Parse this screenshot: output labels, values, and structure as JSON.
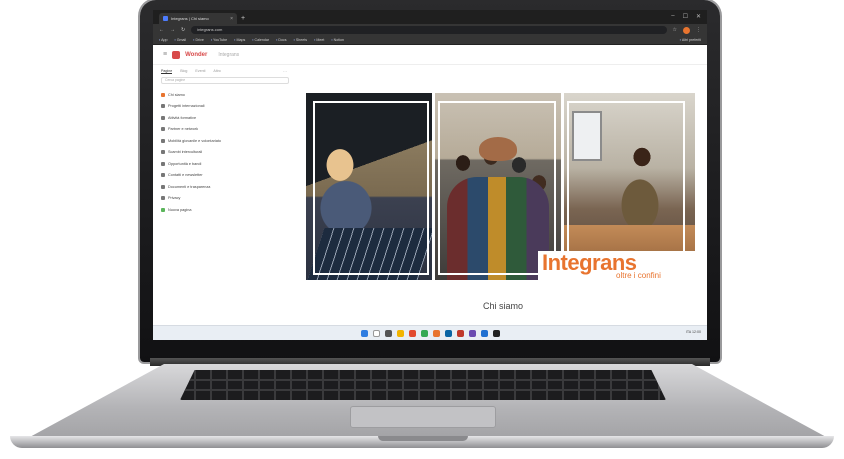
{
  "browser": {
    "tab_title": "Integrans | Chi siamo",
    "new_tab": "+",
    "url": "integrans.com",
    "window_controls": [
      "–",
      "☐",
      "✕"
    ],
    "bookmarks": [
      "App",
      "Gmail",
      "Drive",
      "YouTube",
      "Maps",
      "Calendar",
      "Docs",
      "Sheets",
      "Meet",
      "Notion",
      "Altri preferiti"
    ]
  },
  "app": {
    "brand": "Wonder",
    "breadcrumb": "Integrans",
    "sidebar": {
      "tabs": [
        "Pagine",
        "Blog",
        "Eventi",
        "Altro"
      ],
      "filter_placeholder": "Cerca pagine",
      "items": [
        {
          "label": "Chi siamo",
          "icon": "home-icon"
        },
        {
          "label": "Progetti internazionali",
          "icon": "page-icon"
        },
        {
          "label": "Attività formative",
          "icon": "page-icon"
        },
        {
          "label": "Partner e network",
          "icon": "page-icon"
        },
        {
          "label": "Mobilità giovanile e volontariato",
          "icon": "page-icon"
        },
        {
          "label": "Scambi interculturali",
          "icon": "page-icon"
        },
        {
          "label": "Opportunità e bandi",
          "icon": "page-icon"
        },
        {
          "label": "Contatti e newsletter",
          "icon": "page-icon"
        },
        {
          "label": "Documenti e trasparenza",
          "icon": "page-icon"
        },
        {
          "label": "Privacy",
          "icon": "page-icon"
        },
        {
          "label": "Nuova pagina",
          "icon": "plus-icon"
        }
      ]
    }
  },
  "hero": {
    "logo_main": "Integrans",
    "logo_sub": "oltre i confini",
    "caption": "Chi siamo"
  },
  "taskbar": {
    "tray_text": "ITA 12:00"
  },
  "colors": {
    "accent": "#e8742f",
    "brand": "#d84a4a"
  }
}
